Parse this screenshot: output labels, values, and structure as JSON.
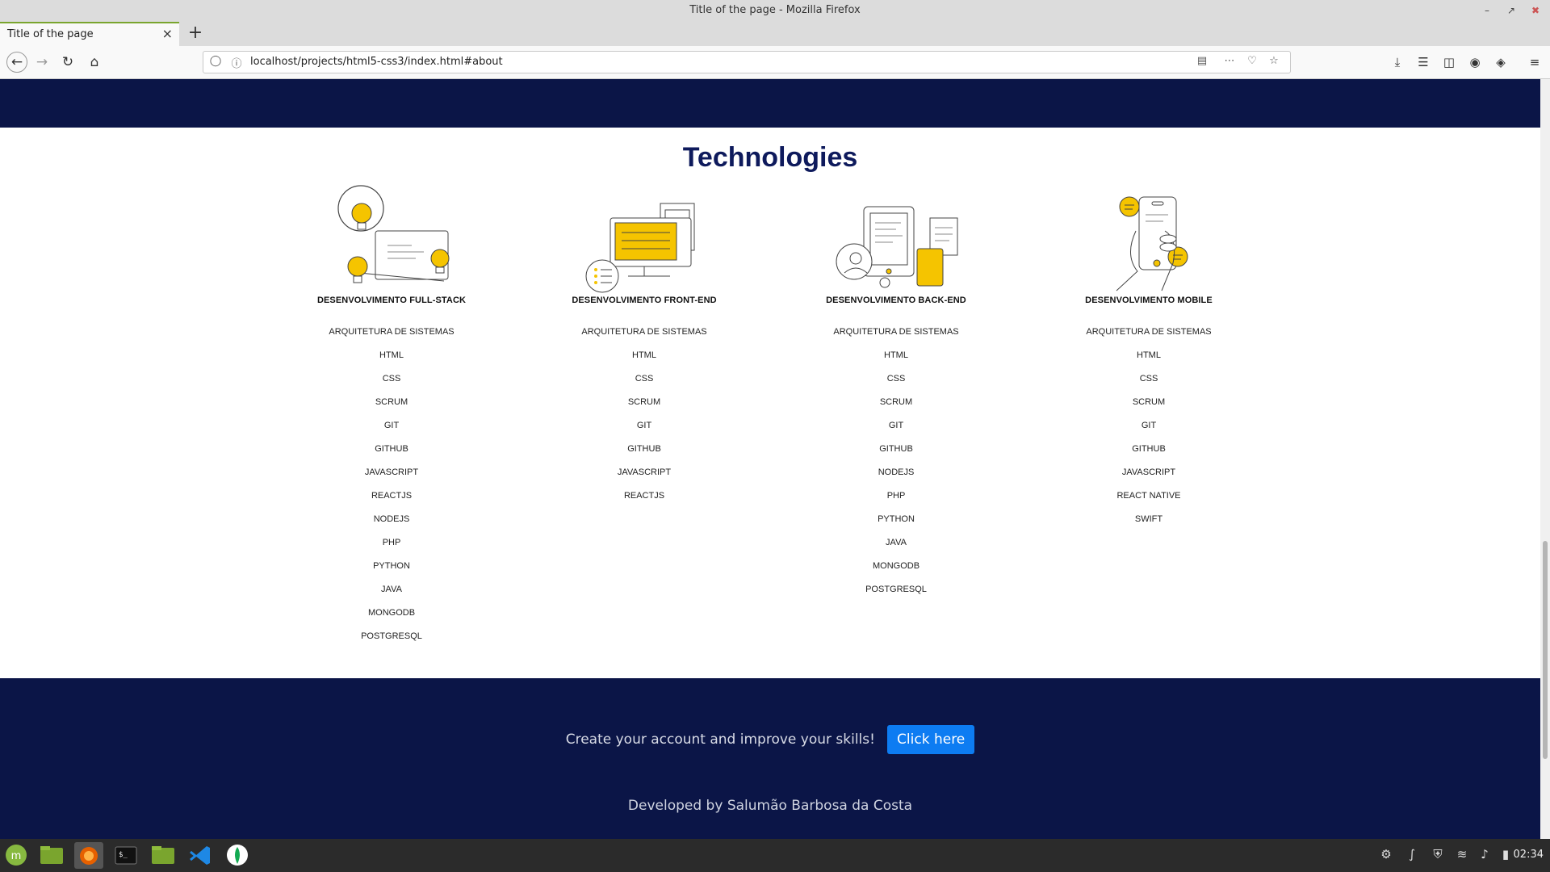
{
  "window": {
    "title": "Title of the page - Mozilla Firefox"
  },
  "tab": {
    "title": "Title of the page"
  },
  "navbar": {
    "url": "localhost/projects/html5-css3/index.html#about"
  },
  "page": {
    "section_title": "Technologies",
    "columns": [
      {
        "title": "DESENVOLVIMENTO FULL-STACK",
        "items": [
          "ARQUITETURA DE SISTEMAS",
          "HTML",
          "CSS",
          "SCRUM",
          "GIT",
          "GITHUB",
          "JAVASCRIPT",
          "REACTJS",
          "NODEJS",
          "PHP",
          "PYTHON",
          "JAVA",
          "MONGODB",
          "POSTGRESQL"
        ]
      },
      {
        "title": "DESENVOLVIMENTO FRONT-END",
        "items": [
          "ARQUITETURA DE SISTEMAS",
          "HTML",
          "CSS",
          "SCRUM",
          "GIT",
          "GITHUB",
          "JAVASCRIPT",
          "REACTJS"
        ]
      },
      {
        "title": "DESENVOLVIMENTO BACK-END",
        "items": [
          "ARQUITETURA DE SISTEMAS",
          "HTML",
          "CSS",
          "SCRUM",
          "GIT",
          "GITHUB",
          "NODEJS",
          "PHP",
          "PYTHON",
          "JAVA",
          "MONGODB",
          "POSTGRESQL"
        ]
      },
      {
        "title": "DESENVOLVIMENTO MOBILE",
        "items": [
          "ARQUITETURA DE SISTEMAS",
          "HTML",
          "CSS",
          "SCRUM",
          "GIT",
          "GITHUB",
          "JAVASCRIPT",
          "REACT NATIVE",
          "SWIFT"
        ]
      }
    ],
    "cta_text": "Create your account and improve your skills!",
    "cta_button": "Click here",
    "developer": "Developed by Salumão Barbosa da Costa"
  },
  "taskbar": {
    "clock": "02:34"
  },
  "colors": {
    "navy": "#0b1547",
    "accent_yellow": "#f5c400",
    "button_blue": "#0d7cf2"
  }
}
